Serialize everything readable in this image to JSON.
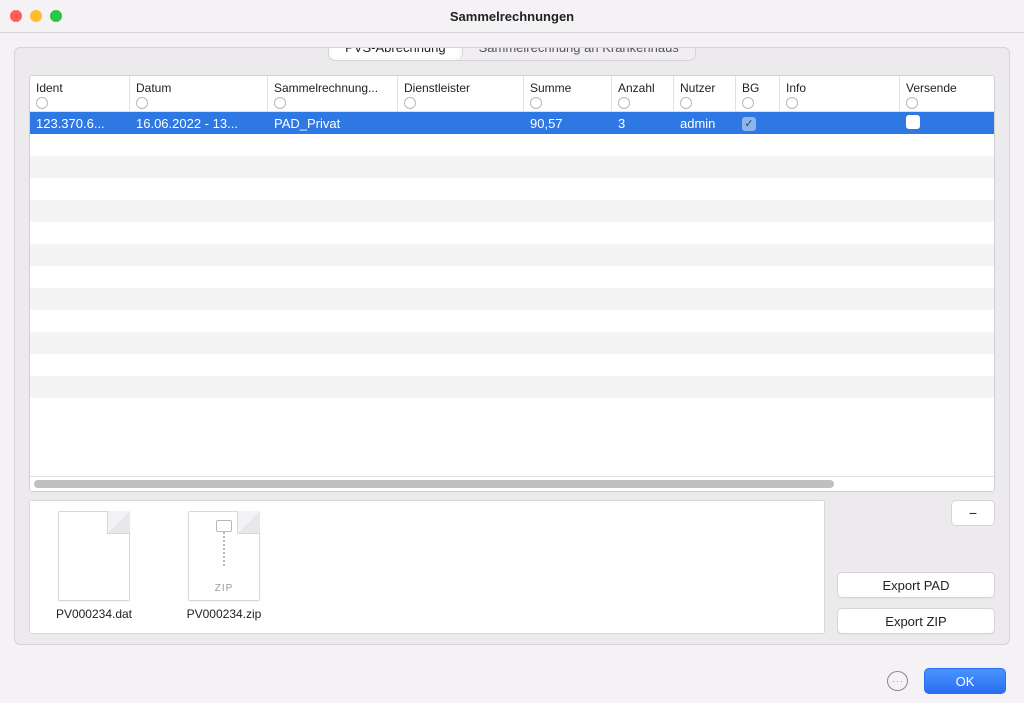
{
  "window": {
    "title": "Sammelrechnungen"
  },
  "tabs": {
    "items": [
      {
        "label": "PVS-Abrechnung",
        "active": true
      },
      {
        "label": "Sammelrechnung an Krankenhaus",
        "active": false
      }
    ]
  },
  "table": {
    "columns": [
      {
        "key": "ident",
        "label": "Ident"
      },
      {
        "key": "datum",
        "label": "Datum"
      },
      {
        "key": "sammel",
        "label": "Sammelrechnung..."
      },
      {
        "key": "dienst",
        "label": "Dienstleister"
      },
      {
        "key": "summe",
        "label": "Summe"
      },
      {
        "key": "anzahl",
        "label": "Anzahl"
      },
      {
        "key": "nutzer",
        "label": "Nutzer"
      },
      {
        "key": "bg",
        "label": "BG"
      },
      {
        "key": "info",
        "label": "Info"
      },
      {
        "key": "versend",
        "label": "Versende"
      }
    ],
    "rows": [
      {
        "selected": true,
        "ident": "123.370.6...",
        "datum": "16.06.2022 - 13...",
        "sammel": "PAD_Privat",
        "dienst": "",
        "summe": "90,57",
        "anzahl": "3",
        "nutzer": "admin",
        "bg_checked": true,
        "info": "",
        "versend_checked": false
      }
    ]
  },
  "files": [
    {
      "name": "PV000234.dat",
      "kind": "dat"
    },
    {
      "name": "PV000234.zip",
      "kind": "zip",
      "type_label": "ZIP"
    }
  ],
  "buttons": {
    "remove": "–",
    "export_pad": "Export PAD",
    "export_zip": "Export ZIP",
    "ok": "OK"
  }
}
